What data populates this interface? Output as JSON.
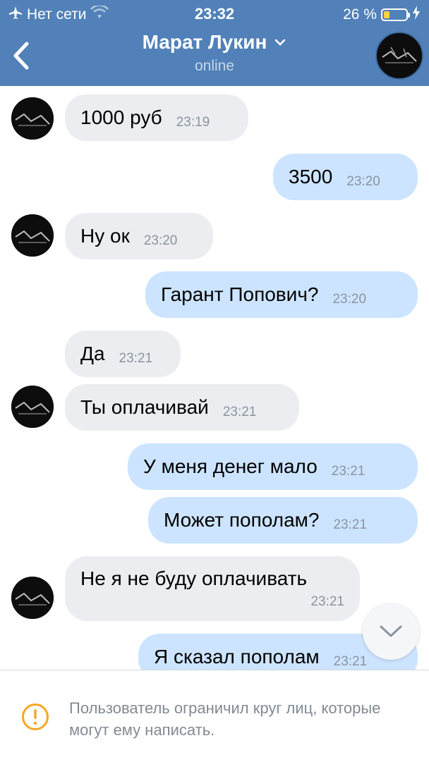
{
  "status_bar": {
    "network": "Нет сети",
    "time": "23:32",
    "battery_text": "26 %",
    "battery_level": 0.26
  },
  "header": {
    "name": "Марат Лукин",
    "status": "online"
  },
  "messages": [
    {
      "side": "in",
      "text": "1000 руб",
      "time": "23:19"
    },
    {
      "side": "out",
      "text": "3500",
      "time": "23:20"
    },
    {
      "side": "in",
      "text": "Ну ок",
      "time": "23:20"
    },
    {
      "side": "out",
      "text": "Гарант Попович?",
      "time": "23:20"
    },
    {
      "side": "in",
      "text": "Да",
      "time": "23:21"
    },
    {
      "side": "in",
      "text": "Ты оплачивай",
      "time": "23:21"
    },
    {
      "side": "out",
      "text": "У меня денег мало",
      "time": "23:21"
    },
    {
      "side": "out",
      "text": "Может пополам?",
      "time": "23:21"
    },
    {
      "side": "in",
      "text": "Не я не буду оплачивать",
      "time": "23:21"
    },
    {
      "side": "out",
      "text": "Я сказал пополам",
      "time": "23:21"
    }
  ],
  "footer": {
    "notice": "Пользователь ограничил круг лиц, которые могут ему написать."
  },
  "colors": {
    "header_bg": "#5181b8",
    "incoming_bubble": "#ebedf0",
    "outgoing_bubble": "#cce4ff",
    "warning": "#f5a623",
    "battery": "#ffd23f"
  },
  "icons": [
    "airplane-icon",
    "wifi-icon",
    "battery-icon",
    "charging-bolt-icon",
    "back-chevron-icon",
    "chevron-down-icon",
    "scroll-down-icon",
    "warning-icon"
  ]
}
